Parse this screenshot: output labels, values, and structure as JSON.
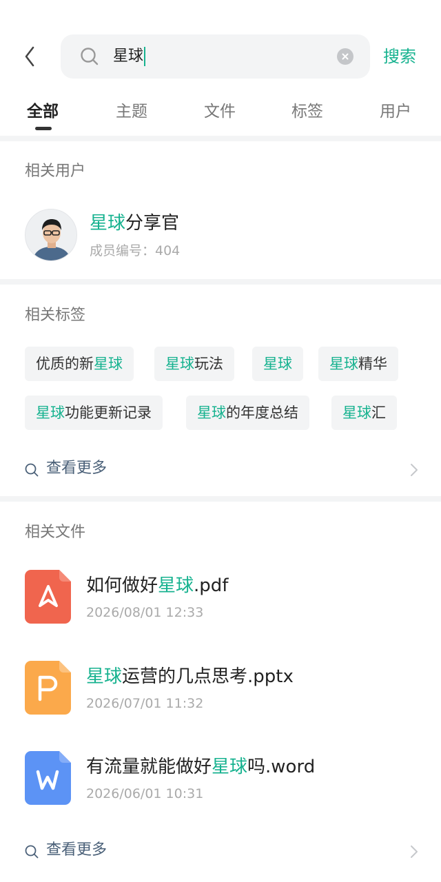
{
  "search": {
    "query": "星球",
    "submit_label": "搜索"
  },
  "tabs": [
    {
      "label": "全部",
      "active": true
    },
    {
      "label": "主题",
      "active": false
    },
    {
      "label": "文件",
      "active": false
    },
    {
      "label": "标签",
      "active": false
    },
    {
      "label": "用户",
      "active": false
    }
  ],
  "users_section": {
    "title": "相关用户",
    "users": [
      {
        "name_highlight": "星球",
        "name_rest": "分享官",
        "meta": "成员编号：404"
      }
    ]
  },
  "tags_section": {
    "title": "相关标签",
    "tags": [
      {
        "before": "优质的新",
        "highlight": "星球",
        "after": ""
      },
      {
        "before": "",
        "highlight": "星球",
        "after": "玩法"
      },
      {
        "before": "",
        "highlight": "星球",
        "after": ""
      },
      {
        "before": "",
        "highlight": "星球",
        "after": "精华"
      },
      {
        "before": "",
        "highlight": "星球",
        "after": "功能更新记录"
      },
      {
        "before": "",
        "highlight": "星球",
        "after": "的年度总结"
      },
      {
        "before": "",
        "highlight": "星球",
        "after": "汇"
      }
    ],
    "more_label": "查看更多"
  },
  "files_section": {
    "title": "相关文件",
    "files": [
      {
        "before": "如何做好",
        "highlight": "星球",
        "after": ".pdf",
        "time": "2026/08/01 12:33",
        "type": "pdf-icon",
        "color": "#f0654e"
      },
      {
        "before": "",
        "highlight": "星球",
        "after": "运营的几点思考.pptx",
        "time": "2026/07/01 11:32",
        "type": "ppt-icon",
        "color": "#fba94b"
      },
      {
        "before": "有流量就能做好",
        "highlight": "星球",
        "after": "吗.word",
        "time": "2026/06/01 10:31",
        "type": "word-icon",
        "color": "#5c93f5"
      }
    ],
    "more_label": "查看更多"
  },
  "colors": {
    "accent": "#16b28f",
    "link": "#4a6078",
    "divider": "#f3f4f5"
  }
}
